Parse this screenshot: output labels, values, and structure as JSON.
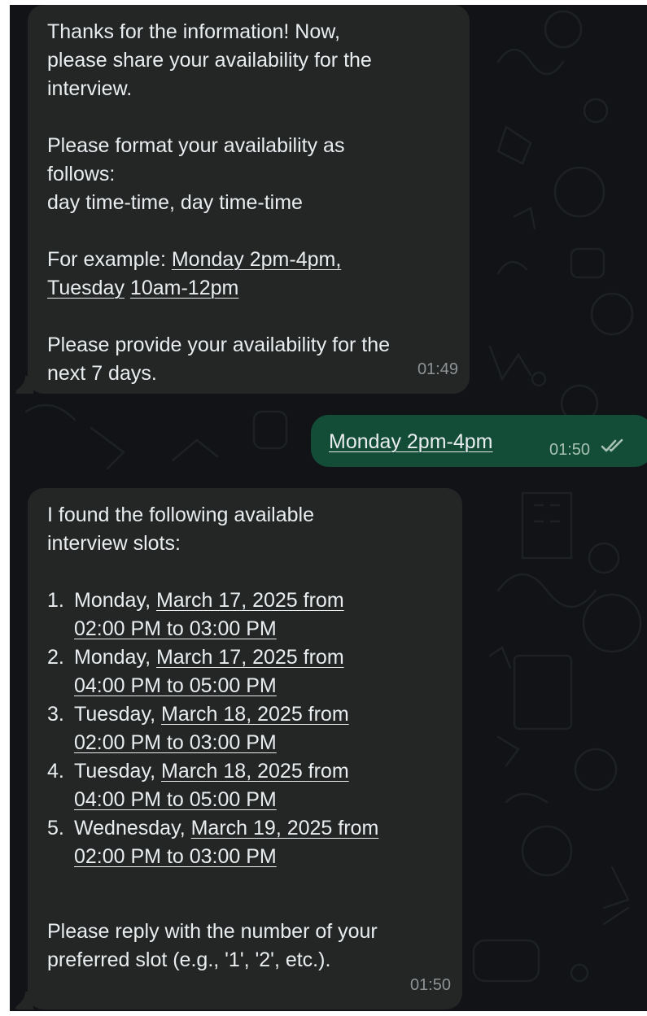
{
  "colors": {
    "background": "#111317",
    "incoming_bubble": "#242626",
    "outgoing_bubble": "#144d37",
    "text": "#e9edef",
    "timestamp": "#8e9396",
    "read_ticks": "#a8c1b5"
  },
  "messages": [
    {
      "direction": "incoming",
      "lines": {
        "l1": "Thanks for the information! Now,",
        "l2": "please share your availability for the",
        "l3": "interview.",
        "l4": "Please format your availability as",
        "l5": "follows:",
        "l6": "day time-time, day time-time",
        "l7_prefix": "For example: ",
        "l7_link": "Monday 2pm-4pm,",
        "l8_link_a": "Tuesday",
        "l8_link_b": "10am-12pm",
        "l9": "Please provide your availability for the",
        "l10": "next 7 days."
      },
      "time": "01:49"
    },
    {
      "direction": "outgoing",
      "text": "Monday 2pm-4pm",
      "time": "01:50",
      "status_icon": "double-check-icon"
    },
    {
      "direction": "incoming",
      "intro_1": "I found the following available",
      "intro_2": "interview slots:",
      "slots": [
        {
          "num": "1.",
          "day": "Monday, ",
          "link_1": "March 17, 2025 from",
          "link_2": "02:00 PM to 03:00 PM"
        },
        {
          "num": "2.",
          "day": "Monday, ",
          "link_1": "March 17, 2025 from",
          "link_2": "04:00 PM to 05:00 PM"
        },
        {
          "num": "3.",
          "day": "Tuesday, ",
          "link_1": "March 18, 2025 from",
          "link_2": "02:00 PM to 03:00 PM"
        },
        {
          "num": "4.",
          "day": "Tuesday, ",
          "link_1": "March 18, 2025 from",
          "link_2": "04:00 PM to 05:00 PM"
        },
        {
          "num": "5.",
          "day": "Wednesday, ",
          "link_1": "March 19, 2025 from",
          "link_2": "02:00 PM to 03:00 PM"
        }
      ],
      "outro_1": "Please reply with the number of your",
      "outro_2": "preferred slot (e.g., '1', '2', etc.).",
      "time": "01:50"
    }
  ]
}
